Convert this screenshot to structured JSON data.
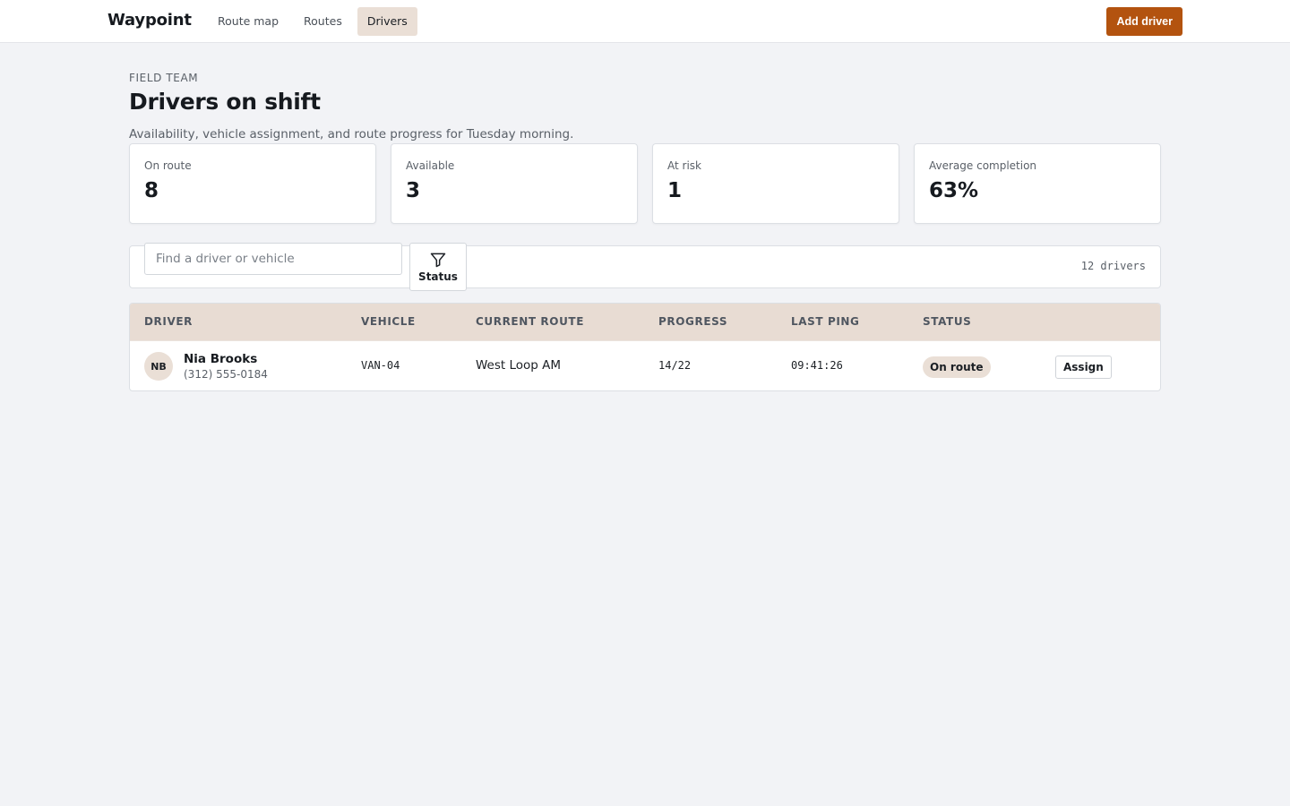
{
  "app": {
    "name": "Waypoint"
  },
  "nav": {
    "items": [
      {
        "label": "Route map",
        "active": false
      },
      {
        "label": "Routes",
        "active": false
      },
      {
        "label": "Drivers",
        "active": true
      }
    ]
  },
  "toolbar": {
    "add_label": "Add driver"
  },
  "header": {
    "kicker": "FIELD TEAM",
    "title": "Drivers on shift",
    "subtitle": "Availability, vehicle assignment, and route progress for Tuesday morning."
  },
  "stats": [
    {
      "label": "On route",
      "value": "8"
    },
    {
      "label": "Available",
      "value": "3"
    },
    {
      "label": "At risk",
      "value": "1"
    },
    {
      "label": "Average completion",
      "value": "63%"
    }
  ],
  "filter": {
    "search_placeholder": "Find a driver or vehicle",
    "status_label": "Status",
    "count_text": "12 drivers"
  },
  "table": {
    "headers": [
      "DRIVER",
      "VEHICLE",
      "CURRENT ROUTE",
      "PROGRESS",
      "LAST PING",
      "STATUS"
    ],
    "rows": [
      {
        "initials": "NB",
        "name": "Nia Brooks",
        "phone": "(312) 555-0184",
        "vehicle": "VAN-04",
        "route": "West Loop AM",
        "progress": "14/22",
        "last_ping": "09:41:26",
        "status": "On route",
        "action": "Assign"
      }
    ]
  },
  "colors": {
    "accent": "#b3530f",
    "active_tab": "#eadfd6",
    "table_header": "#e8dcd3",
    "background": "#f2f3f6"
  },
  "icons": {
    "status_filter": "filter-funnel-icon"
  }
}
